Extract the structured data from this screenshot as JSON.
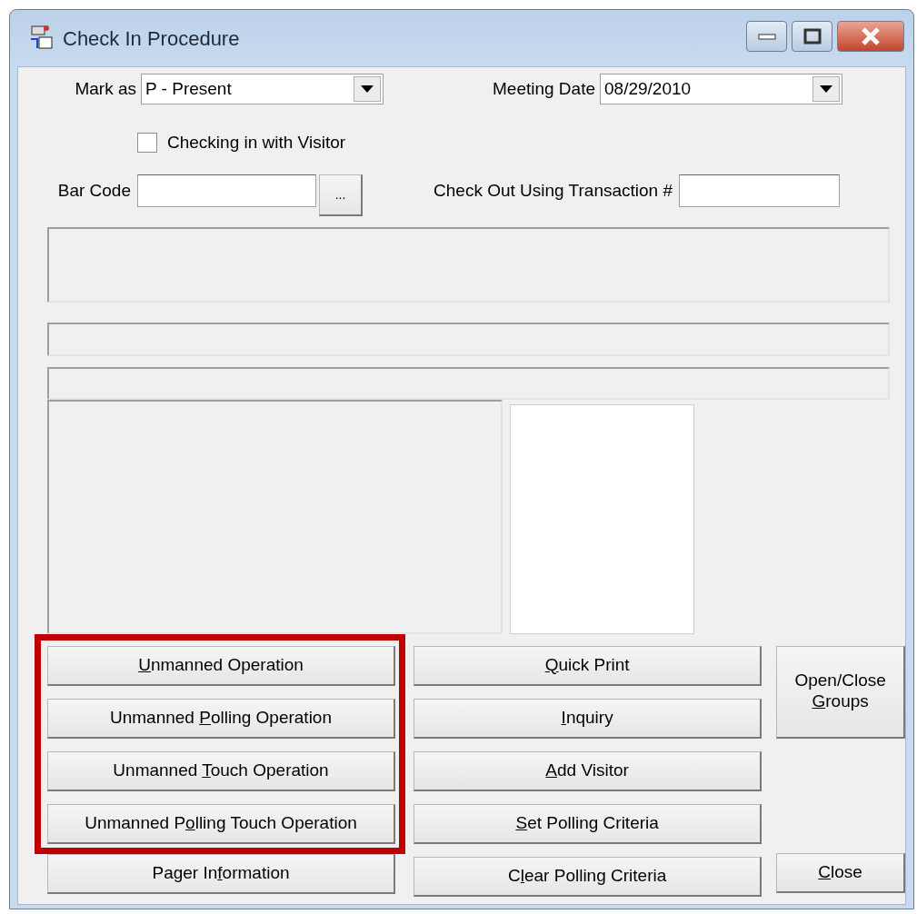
{
  "window": {
    "title": "Check In Procedure"
  },
  "mark_as": {
    "label": "Mark as",
    "value": "P - Present"
  },
  "meeting_date": {
    "label": "Meeting Date",
    "value": "08/29/2010"
  },
  "visitor_checkbox": {
    "label": "Checking in with Visitor",
    "checked": false
  },
  "bar_code": {
    "label": "Bar Code",
    "browse_button": "..."
  },
  "transaction": {
    "label": "Check Out Using Transaction #"
  },
  "left_buttons": [
    {
      "key": "U",
      "after": "nmanned Operation",
      "highlighted": true
    },
    {
      "before": "Unmanned ",
      "key": "P",
      "after": "olling Operation",
      "highlighted": true
    },
    {
      "before": "Unmanned ",
      "key": "T",
      "after": "ouch Operation",
      "highlighted": true
    },
    {
      "before": "Unmanned P",
      "key": "o",
      "after": "lling Touch Operation",
      "highlighted": true
    },
    {
      "before": "Pager In",
      "key": "f",
      "after": "ormation",
      "highlighted": false
    }
  ],
  "middle_buttons": [
    {
      "key": "Q",
      "after": "uick Print"
    },
    {
      "key": "I",
      "after": "nquiry"
    },
    {
      "key": "A",
      "after": "dd Visitor"
    },
    {
      "key": "S",
      "after": "et Polling Criteria"
    },
    {
      "before": "C",
      "key": "l",
      "after": "ear Polling Criteria"
    }
  ],
  "right_buttons": [
    {
      "before": "Open/Close ",
      "key": "G",
      "after": "roups"
    },
    {
      "key": "C",
      "after": "lose"
    }
  ]
}
